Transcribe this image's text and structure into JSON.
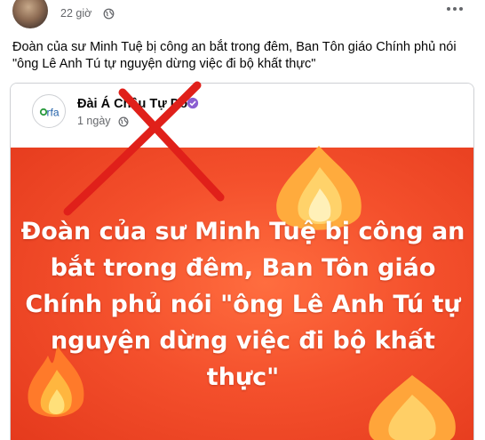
{
  "post": {
    "time": "22 giờ",
    "privacy_icon": "globe-icon",
    "more_icon": "more-options-icon",
    "text": "Đoàn của sư Minh Tuệ bị công an bắt trong đêm, Ban Tôn giáo Chính phủ nói \"ông Lê Anh Tú tự nguyện dừng việc đi bộ khất thực\""
  },
  "shared": {
    "logo_text": "rfa",
    "page_name": "Đài Á Châu Tự Do",
    "time": "1 ngày",
    "verified_icon": "verified-badge-icon",
    "banner_text": "Đoàn của sư Minh Tuệ bị công an bắt trong đêm, Ban Tôn giáo Chính phủ nói \"ông Lê Anh Tú tự nguyện dừng việc đi bộ khất thực\""
  },
  "overlay": {
    "mark": "red-x-cross",
    "color": "#e0201a"
  },
  "colors": {
    "banner": "#f4502c",
    "text_secondary": "#65676b",
    "verified": "#8b5fd1"
  }
}
